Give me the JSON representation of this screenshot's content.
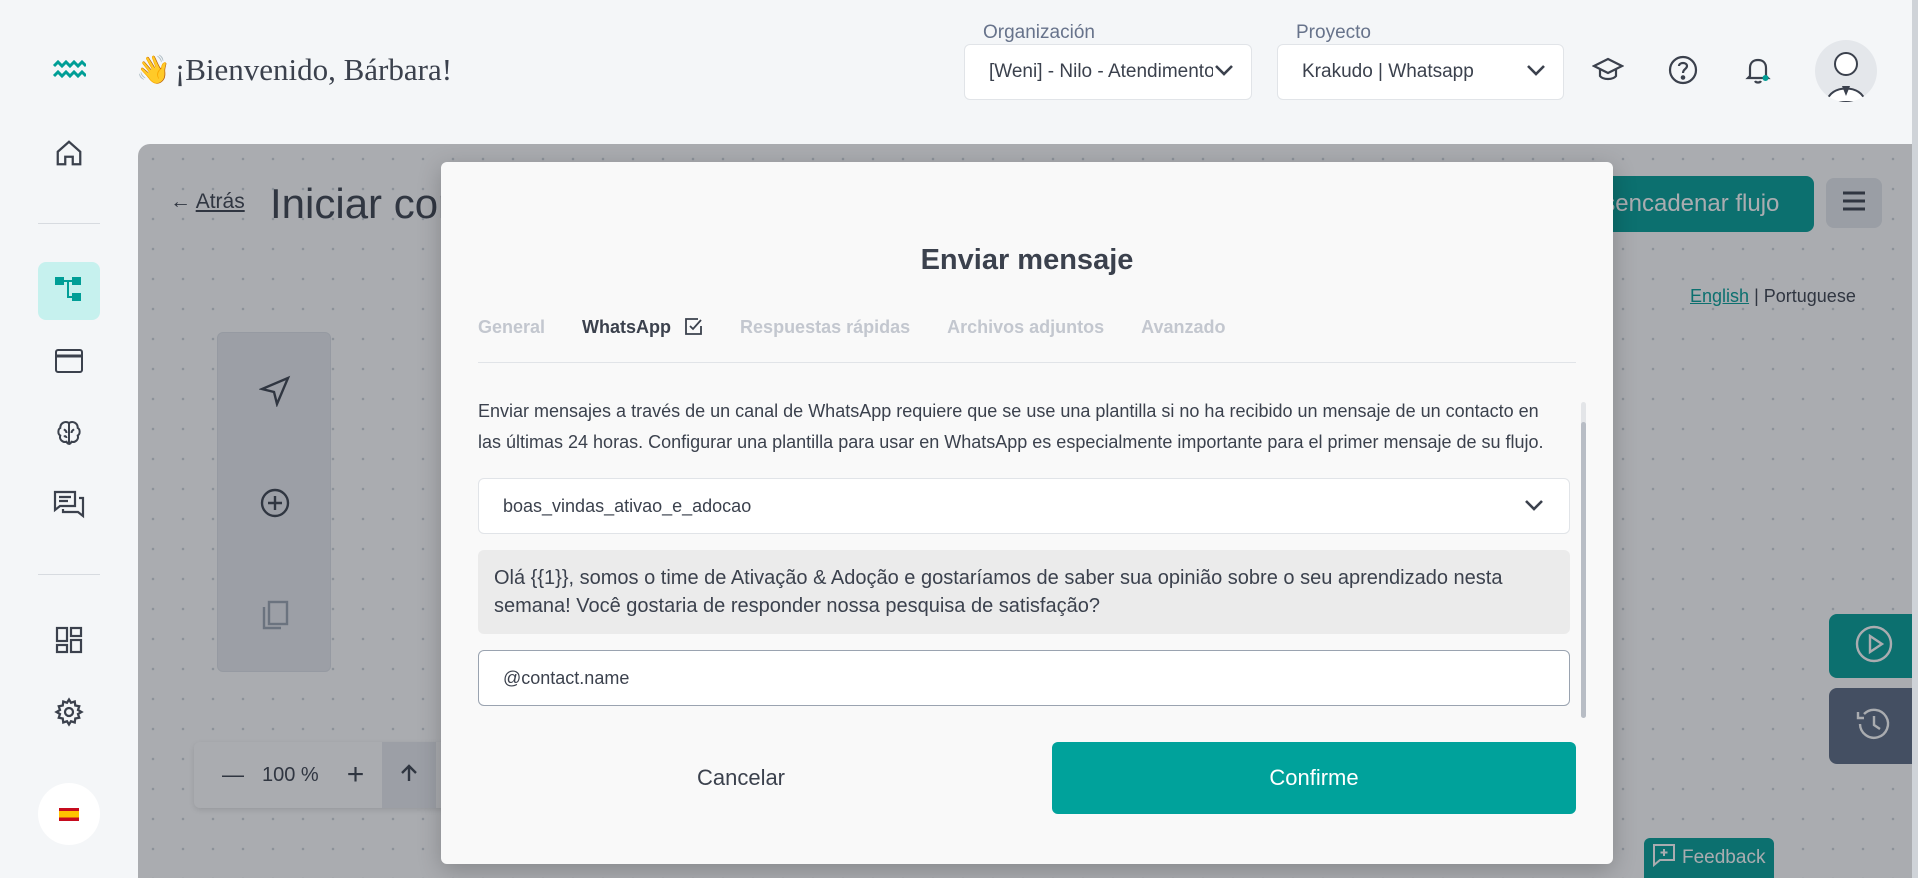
{
  "header": {
    "greeting_emoji": "👋",
    "greeting": "¡Bienvenido, Bárbara!",
    "org_label": "Organización",
    "org_value": "[Weni] - Nilo - Atendimento",
    "project_label": "Proyecto",
    "project_value": "Krakudo | Whatsapp"
  },
  "sidebar": {
    "items": [
      "home-icon",
      "flows-icon",
      "browser-window-icon",
      "brain-icon",
      "chat-icon",
      "dashboard-icon",
      "gear-icon"
    ],
    "language": "es"
  },
  "workspace": {
    "back_arrow": "←",
    "back_label": "Atrás",
    "title": "Iniciar con",
    "trigger_label": "Desencadenar flujo",
    "lang_english": "English",
    "lang_separator": "|",
    "lang_portuguese": "Portuguese",
    "zoom_value": "100 %",
    "zoom_minus": "—",
    "zoom_plus": "+",
    "feedback_label": "Feedback"
  },
  "modal": {
    "title": "Enviar mensaje",
    "tabs": [
      {
        "label": "General",
        "active": false
      },
      {
        "label": "WhatsApp",
        "active": true
      },
      {
        "label": "Respuestas rápidas",
        "active": false
      },
      {
        "label": "Archivos adjuntos",
        "active": false
      },
      {
        "label": "Avanzado",
        "active": false
      }
    ],
    "description": "Enviar mensajes a través de un canal de WhatsApp requiere que se use una plantilla si no ha recibido un mensaje de un contacto en las últimas 24 horas. Configurar una plantilla para usar en WhatsApp es especialmente importante para el primer mensaje de su flujo.",
    "template_value": "boas_vindas_ativao_e_adocao",
    "template_preview": "Olá {{1}}, somos o time de Ativação & Adoção e gostaríamos de saber sua opinião sobre o seu aprendizado nesta semana! Você gostaria de responder nossa pesquisa de satisfação?",
    "variable_value": "@contact.name",
    "cancel_label": "Cancelar",
    "confirm_label": "Confirme"
  },
  "colors": {
    "accent": "#009e96",
    "active_nav_bg": "#c6f1ee",
    "text": "#3b414d"
  }
}
